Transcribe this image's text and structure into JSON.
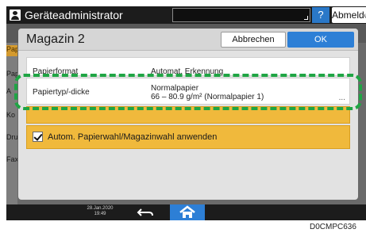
{
  "topbar": {
    "title": "Geräteadministrator",
    "help_label": "?",
    "logout_label": "Abmelden"
  },
  "background": {
    "tabs": [
      "Pap",
      "Pap",
      "A",
      "Ko",
      "Dru",
      "Fax"
    ]
  },
  "dialog": {
    "title": "Magazin 2",
    "cancel_label": "Abbrechen",
    "ok_label": "OK",
    "rows": [
      {
        "label": "Papierformat",
        "value": "Automat. Erkennung"
      },
      {
        "label": "Papiertyp/-dicke",
        "value_line1": "Normalpapier",
        "value_line2": "66 – 80.9 g/m² (Normalpapier 1)",
        "more": "..."
      }
    ],
    "checkbox_label": "Autom. Papierwahl/Magazinwahl anwenden",
    "checkbox_checked": true
  },
  "bottombar": {
    "date": "28.Jan.2020",
    "time": "19:49"
  },
  "figure_code": "D0CMPC636",
  "colors": {
    "ok": "#2d7fd6",
    "highlight": "#1fa544",
    "warning": "#f0b93c"
  }
}
